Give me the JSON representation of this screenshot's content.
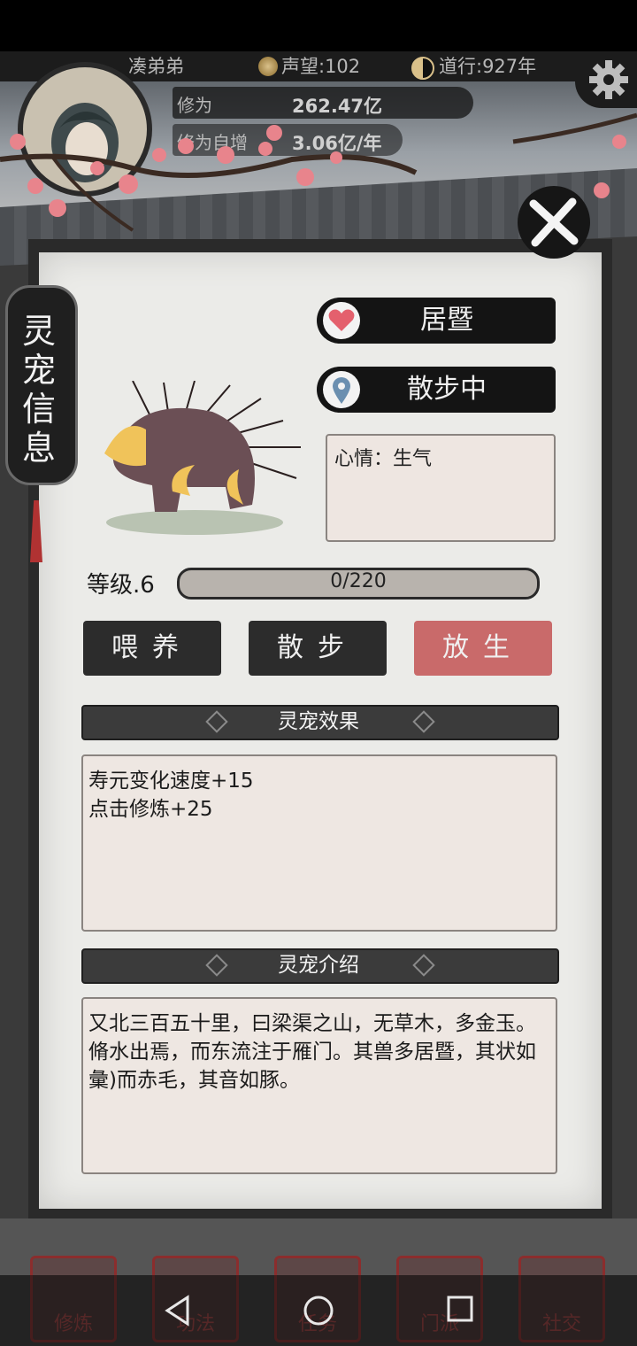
{
  "hud": {
    "player_name": "凑弟弟",
    "reputation": "声望:102",
    "daoxing": "道行:927年",
    "cultivation_label": "修为",
    "cultivation_value": "262.47亿",
    "growth_label": "修为自增",
    "growth_value": "3.06亿/年"
  },
  "panel": {
    "side_label": "灵宠信息",
    "pet_name": "居暨",
    "pet_status": "散步中",
    "mood": "心情：生气",
    "level": "等级.6",
    "xp": "0/220",
    "xp_fraction": 0.0
  },
  "actions": {
    "feed": "喂养",
    "walk": "散步",
    "release": "放生"
  },
  "effects": {
    "title": "灵宠效果",
    "lines": [
      "寿元变化速度+15",
      "点击修炼+25"
    ]
  },
  "intro": {
    "title": "灵宠介绍",
    "text": "又北三百五十里，曰梁渠之山，无草木，多金玉。脩水出焉，而东流注于雁门。其兽多居暨，其状如彙)而赤毛，其音如豚。"
  },
  "bottom_nav": [
    "修炼",
    "功法",
    "任务",
    "门派",
    "社交"
  ],
  "icons": {
    "heart": "heart-icon",
    "location": "location-pin-icon",
    "close": "close-icon",
    "settings": "gear-icon"
  },
  "colors": {
    "release_button": "#c96a6a",
    "dark_button": "#2a2a2a",
    "heart": "#e4606d"
  }
}
